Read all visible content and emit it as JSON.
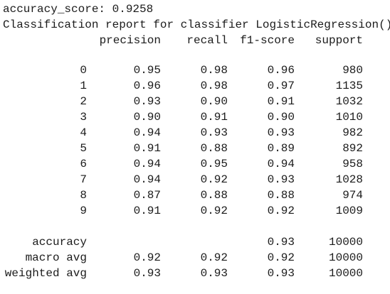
{
  "accuracy_line": "accuracy_score: 0.9258",
  "report_title": "Classification report for classifier LogisticRegression()",
  "headers": [
    "precision",
    "recall",
    "f1-score",
    "support"
  ],
  "rows": [
    {
      "label": "0",
      "precision": "0.95",
      "recall": "0.98",
      "f1": "0.96",
      "support": "980"
    },
    {
      "label": "1",
      "precision": "0.96",
      "recall": "0.98",
      "f1": "0.97",
      "support": "1135"
    },
    {
      "label": "2",
      "precision": "0.93",
      "recall": "0.90",
      "f1": "0.91",
      "support": "1032"
    },
    {
      "label": "3",
      "precision": "0.90",
      "recall": "0.91",
      "f1": "0.90",
      "support": "1010"
    },
    {
      "label": "4",
      "precision": "0.94",
      "recall": "0.93",
      "f1": "0.93",
      "support": "982"
    },
    {
      "label": "5",
      "precision": "0.91",
      "recall": "0.88",
      "f1": "0.89",
      "support": "892"
    },
    {
      "label": "6",
      "precision": "0.94",
      "recall": "0.95",
      "f1": "0.94",
      "support": "958"
    },
    {
      "label": "7",
      "precision": "0.94",
      "recall": "0.92",
      "f1": "0.93",
      "support": "1028"
    },
    {
      "label": "8",
      "precision": "0.87",
      "recall": "0.88",
      "f1": "0.88",
      "support": "974"
    },
    {
      "label": "9",
      "precision": "0.91",
      "recall": "0.92",
      "f1": "0.92",
      "support": "1009"
    }
  ],
  "summary": [
    {
      "label": "accuracy",
      "precision": "",
      "recall": "",
      "f1": "0.93",
      "support": "10000"
    },
    {
      "label": "macro avg",
      "precision": "0.92",
      "recall": "0.92",
      "f1": "0.92",
      "support": "10000"
    },
    {
      "label": "weighted avg",
      "precision": "0.93",
      "recall": "0.93",
      "f1": "0.93",
      "support": "10000"
    }
  ]
}
